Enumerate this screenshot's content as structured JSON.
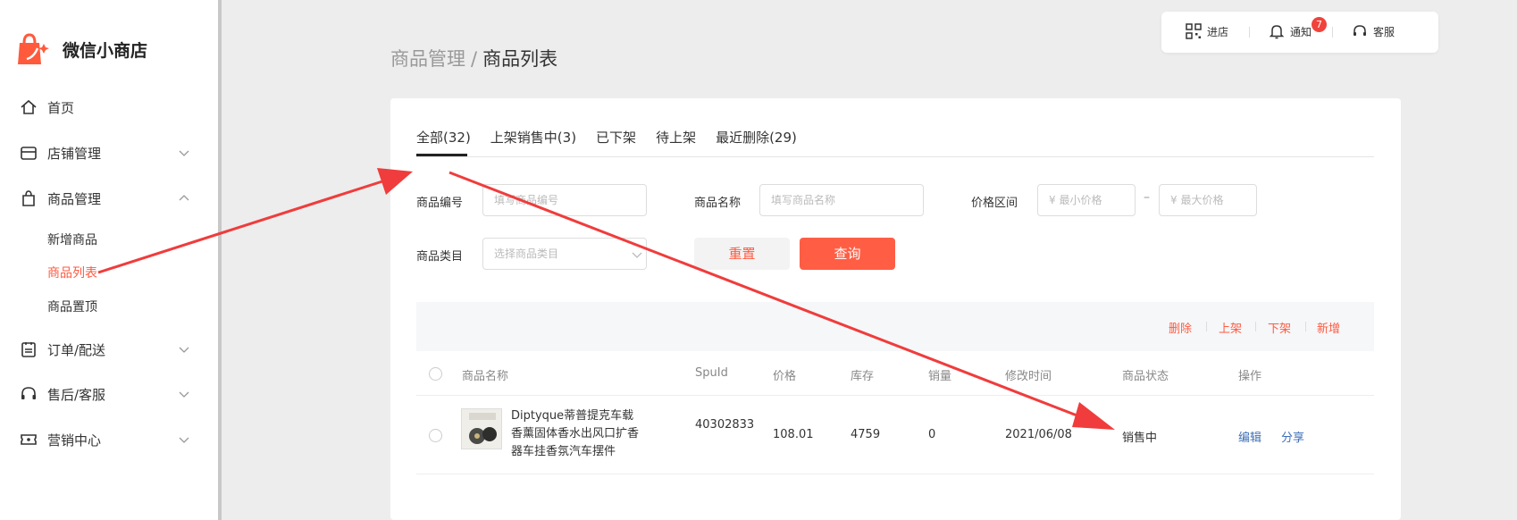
{
  "app": {
    "name": "微信小商店"
  },
  "sidebar": {
    "items": [
      {
        "label": "首页"
      },
      {
        "label": "店铺管理"
      },
      {
        "label": "商品管理"
      },
      {
        "label": "订单/配送"
      },
      {
        "label": "售后/客服"
      },
      {
        "label": "营销中心"
      }
    ],
    "sub_items": [
      {
        "label": "新增商品"
      },
      {
        "label": "商品列表"
      },
      {
        "label": "商品置顶"
      }
    ]
  },
  "topbar": {
    "store": "进店",
    "notify": "通知",
    "notify_badge": "7",
    "service": "客服"
  },
  "breadcrumb": {
    "parent": "商品管理",
    "separator": "/",
    "current": "商品列表"
  },
  "tabs": [
    {
      "label": "全部(32)"
    },
    {
      "label": "上架销售中(3)"
    },
    {
      "label": "已下架"
    },
    {
      "label": "待上架"
    },
    {
      "label": "最近删除(29)"
    }
  ],
  "filters": {
    "code_label": "商品编号",
    "code_placeholder": "填写商品编号",
    "name_label": "商品名称",
    "name_placeholder": "填写商品名称",
    "price_label": "价格区间",
    "price_min_placeholder": "¥  最小价格",
    "price_dash": "–",
    "price_max_placeholder": "¥  最大价格",
    "category_label": "商品类目",
    "category_placeholder": "选择商品类目",
    "reset": "重置",
    "query": "查询"
  },
  "toolbar": {
    "delete": "删除",
    "list": "上架",
    "unlist": "下架",
    "add": "新增"
  },
  "table": {
    "headers": [
      "商品名称",
      "SpuId",
      "价格",
      "库存",
      "销量",
      "修改时间",
      "商品状态",
      "操作"
    ],
    "rows": [
      {
        "name": "Diptyque蒂普提克车载香薰固体香水出风口扩香器车挂香氛汽车摆件",
        "spuid": "40302833",
        "price": "108.01",
        "stock": "4759",
        "sales": "0",
        "modified": "2021/06/08",
        "status": "销售中",
        "edit": "编辑",
        "share": "分享"
      }
    ]
  },
  "colors": {
    "accent": "#ff5e45",
    "link": "#3f6fb5",
    "arrow": "#f03c3c"
  }
}
